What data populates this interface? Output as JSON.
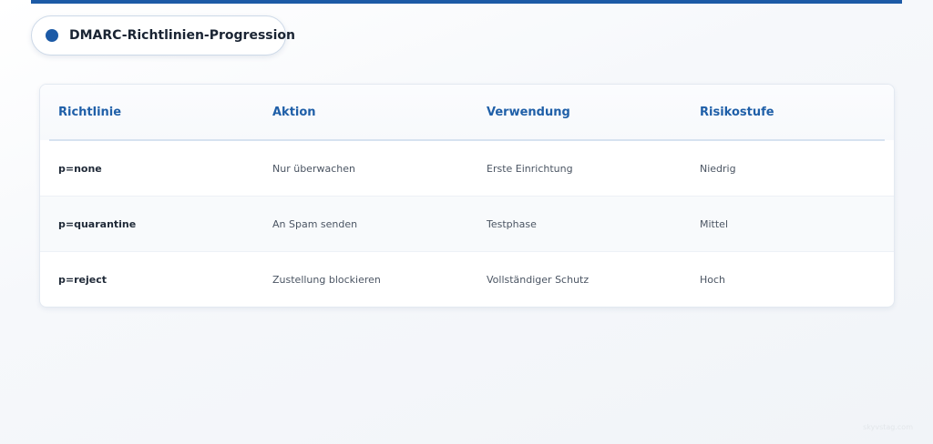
{
  "header": {
    "title": "DMARC-Richtlinien-Progression"
  },
  "table": {
    "columns": [
      "Richtlinie",
      "Aktion",
      "Verwendung",
      "Risikostufe"
    ],
    "rows": [
      [
        "p=none",
        "Nur überwachen",
        "Erste Einrichtung",
        "Niedrig"
      ],
      [
        "p=quarantine",
        "An Spam senden",
        "Testphase",
        "Mittel"
      ],
      [
        "p=reject",
        "Zustellung blockieren",
        "Vollständiger Schutz",
        "Hoch"
      ]
    ]
  },
  "watermark": "skyvstag.com",
  "colors": {
    "accent": "#1c5aa6",
    "header_text": "#1f5fa8"
  }
}
